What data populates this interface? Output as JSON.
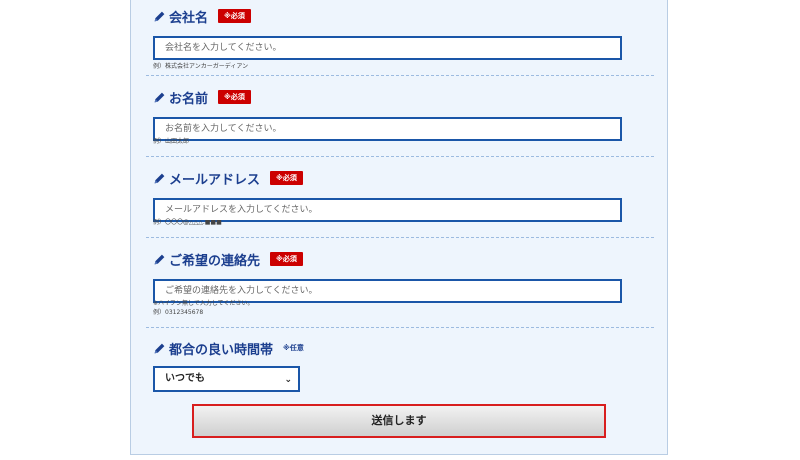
{
  "form": {
    "company": {
      "label": "会社名",
      "badge": "※必須",
      "placeholder": "会社名を入力してください。",
      "hint": "例）株式会社アンカーガーディアン"
    },
    "name": {
      "label": "お名前",
      "badge": "※必須",
      "placeholder": "お名前を入力してください。",
      "hint": "例）山田太郎"
    },
    "email": {
      "label": "メールアドレス",
      "badge": "※必須",
      "placeholder": "メールアドレスを入力してください。",
      "hint": "例）〇〇〇@△△△.■■■"
    },
    "contact": {
      "label": "ご希望の連絡先",
      "badge": "※必須",
      "placeholder": "ご希望の連絡先を入力してください。",
      "hint1": "※ハイフン無しで入力してください。",
      "hint2": "例）0312345678"
    },
    "time": {
      "label": "都合の良い時間帯",
      "optional": "※任意",
      "selected": "いつでも"
    },
    "submit_label": "送信します"
  },
  "colors": {
    "accent": "#1a56a8",
    "required_badge": "#cc0000",
    "panel_bg": "#eef5fd",
    "submit_border": "#d81e1e"
  },
  "icons": {
    "label_icon": "pencil-icon",
    "select_icon": "chevron-down-icon"
  }
}
